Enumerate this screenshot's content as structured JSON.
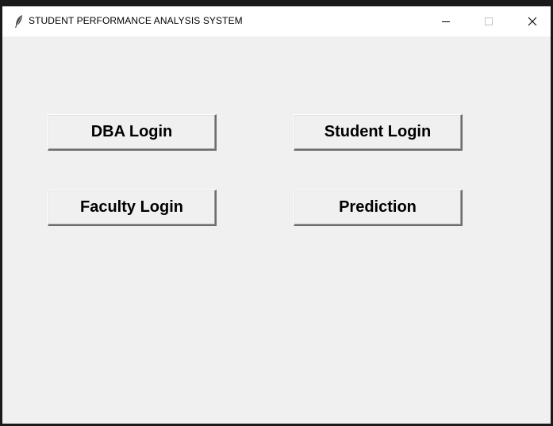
{
  "window": {
    "title": "STUDENT PERFORMANCE ANALYSIS SYSTEM",
    "icon": "feather-icon",
    "controls": {
      "minimize": "minimize-icon",
      "maximize": "maximize-icon",
      "close": "close-icon"
    }
  },
  "buttons": {
    "dba_login": "DBA Login",
    "student_login": "Student Login",
    "faculty_login": "Faculty Login",
    "prediction": "Prediction"
  },
  "colors": {
    "background": "#f0f0f0",
    "titlebar": "#ffffff",
    "frame": "#1a1a1a"
  }
}
